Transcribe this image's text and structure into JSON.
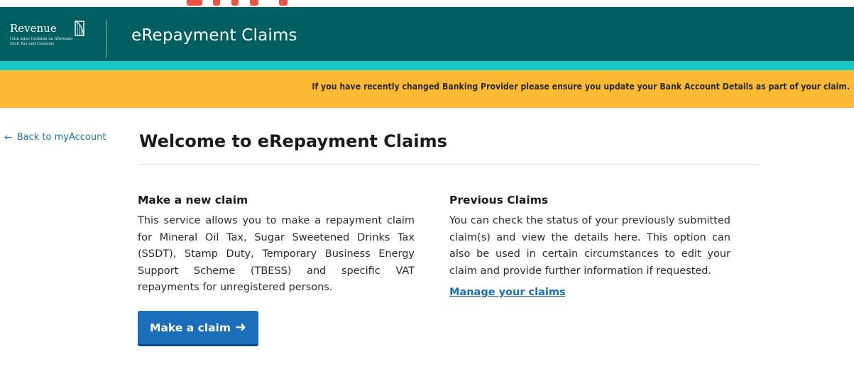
{
  "logo": {
    "wordmark": "Revenue",
    "subtitle_line1": "Cáin agus Custaim na hÉireann",
    "subtitle_line2": "Irish Tax and Customs",
    "icon": "harp-icon"
  },
  "header": {
    "title": "eRepayment Claims"
  },
  "notice": {
    "text": "If you have recently changed Banking Provider please ensure you update your Bank Account Details as part of your claim."
  },
  "nav": {
    "back_label": "Back to myAccount",
    "back_icon": "arrow-left-icon"
  },
  "main": {
    "title": "Welcome to eRepayment Claims",
    "new_claim": {
      "heading": "Make a new claim",
      "body": "This service allows you to make a repayment claim for Mineral Oil Tax, Sugar Sweetened Drinks Tax (SSDT), Stamp Duty, Temporary Business Energy Support Scheme (TBESS) and specific VAT repayments for unregistered persons.",
      "button_label": "Make a claim",
      "button_icon": "arrow-right-icon"
    },
    "previous_claims": {
      "heading": "Previous Claims",
      "body": "You can check the status of your previously submitted claim(s) and view the details here. This option can also be used in certain circumstances to edit your claim and provide further information if requested.",
      "link_label": "Manage your claims"
    }
  },
  "colors": {
    "header": "#005f61",
    "teal_band": "#17c8c4",
    "notice": "#fbb934",
    "link": "#1a6fb8",
    "button": "#1a6fb8"
  }
}
